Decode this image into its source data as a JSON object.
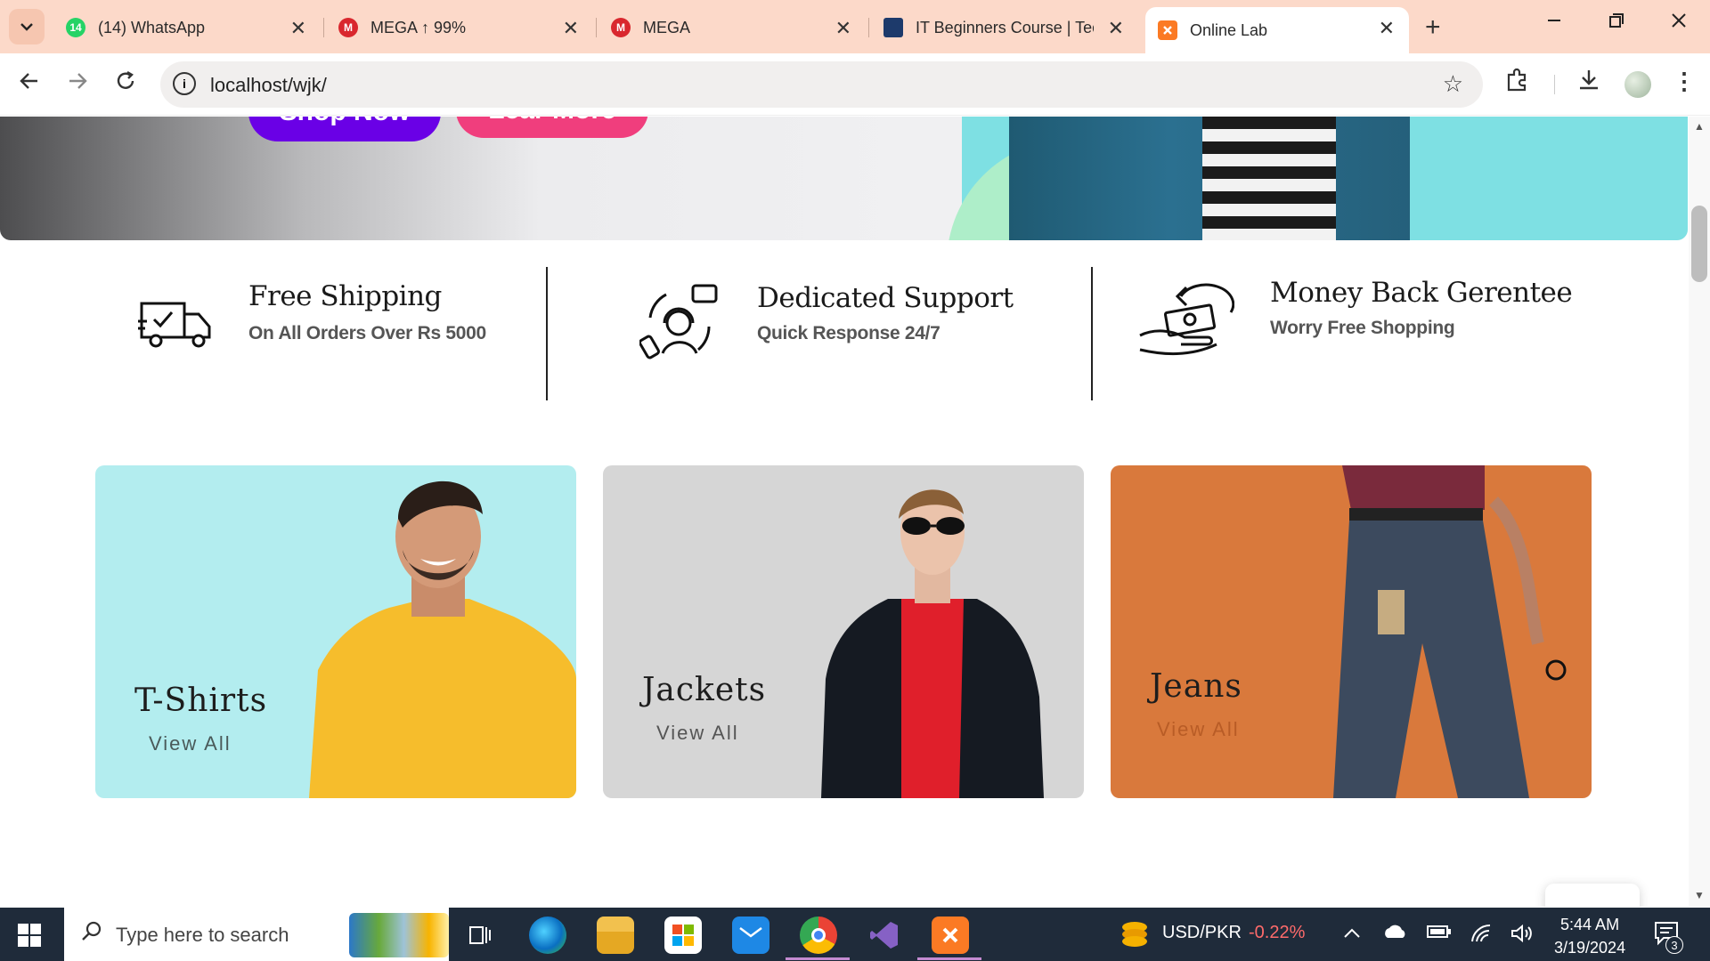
{
  "browser": {
    "tabs": [
      {
        "title": "(14) WhatsApp",
        "badge": "14",
        "icon": "whatsapp-icon"
      },
      {
        "title": "MEGA ↑ 99%",
        "badge": "M",
        "icon": "mega-icon"
      },
      {
        "title": "MEGA",
        "badge": "M",
        "icon": "mega-icon"
      },
      {
        "title": "IT Beginners Course | Tec",
        "badge": "",
        "icon": "course-icon"
      },
      {
        "title": "Online Lab",
        "badge": "",
        "icon": "xampp-icon"
      }
    ],
    "active_tab": 4,
    "url": "localhost/wjk/",
    "new_tab": "+",
    "close": "✕"
  },
  "hero": {
    "buttons": [
      "Shop Now",
      "Lear More"
    ]
  },
  "features": [
    {
      "title": "Free Shipping",
      "subtitle": "On All Orders Over Rs 5000",
      "icon": "delivery-truck-icon"
    },
    {
      "title": "Dedicated Support",
      "subtitle": "Quick  Response  24/7",
      "icon": "customer-support-icon"
    },
    {
      "title": "Money Back Gerentee",
      "subtitle": "Worry  Free  Shopping",
      "icon": "money-back-icon"
    }
  ],
  "categories": [
    {
      "name": "T-Shirts",
      "link": "View All",
      "bg": "#b3edef"
    },
    {
      "name": "Jackets",
      "link": "View All",
      "bg": "#d6d6d6"
    },
    {
      "name": "Jeans",
      "link": "View All",
      "bg": "#d9793c"
    }
  ],
  "cart": {
    "icon": "shopping-bag-icon"
  },
  "taskbar": {
    "search_placeholder": "Type here to search",
    "currency": "USD/PKR",
    "currency_change": "-0.22%",
    "time": "5:44 AM",
    "date": "3/19/2024",
    "notification_count": "3",
    "apps": [
      "task-view-icon",
      "edge-icon",
      "file-explorer-icon",
      "microsoft-store-icon",
      "mail-icon",
      "chrome-icon",
      "visual-studio-icon",
      "xampp-icon"
    ]
  },
  "colors": {
    "tabbar": "#fcd9c9",
    "shop_now": "#6a00e6",
    "learn_more": "#f03e7d",
    "negative": "#ff6b6b"
  }
}
